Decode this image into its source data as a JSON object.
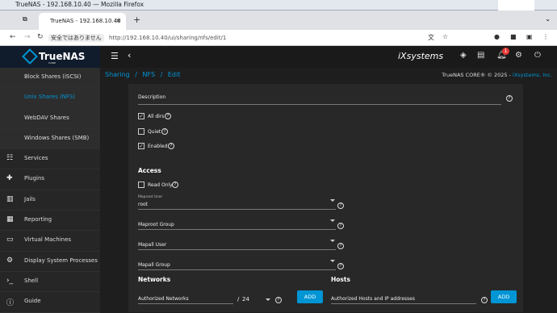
{
  "os": {
    "title": "TrueNAS - 192.168.10.40 — Mozilla Firefox"
  },
  "browser": {
    "tab_label": "TrueNAS - 192.168.10.40",
    "security": "安全ではありません",
    "url": "http://192.168.10.40/ui/sharing/nfs/edit/1"
  },
  "brand": {
    "name": "TrueNAS",
    "edition": "CORE",
    "ix": "iXsystems"
  },
  "notifications": {
    "count": "1"
  },
  "sidebar": {
    "items": [
      {
        "label": "Block Shares (iSCSI)",
        "icon": "none"
      },
      {
        "label": "Unix Shares (NFS)",
        "icon": "none"
      },
      {
        "label": "WebDAV Shares",
        "icon": "none"
      },
      {
        "label": "Windows Shares (SMB)",
        "icon": "none"
      },
      {
        "label": "Services",
        "icon": "sliders-icon"
      },
      {
        "label": "Plugins",
        "icon": "puzzle-icon"
      },
      {
        "label": "Jails",
        "icon": "jail-icon"
      },
      {
        "label": "Reporting",
        "icon": "chart-icon"
      },
      {
        "label": "Virtual Machines",
        "icon": "monitor-icon"
      },
      {
        "label": "Display System Processes",
        "icon": "cog-icon"
      },
      {
        "label": "Shell",
        "icon": "terminal-icon"
      },
      {
        "label": "Guide",
        "icon": "info-icon"
      }
    ]
  },
  "breadcrumb": {
    "a": "Sharing",
    "sep": "/",
    "b": "NFS",
    "c": "Edit"
  },
  "copyright": {
    "text": "TrueNAS CORE® © 2025 - ",
    "link": "iXsystems, Inc."
  },
  "form": {
    "description_label": "Description",
    "all_dirs": "All dirs",
    "quiet": "Quiet",
    "enabled": "Enabled",
    "access_heading": "Access",
    "read_only": "Read Only",
    "maproot_user_label": "Maproot User",
    "maproot_user_value": "root",
    "maproot_group": "Maproot Group",
    "mapall_user": "Mapall User",
    "mapall_group": "Mapall Group",
    "networks_heading": "Networks",
    "hosts_heading": "Hosts",
    "auth_networks": "Authorized Networks",
    "mask_sep": "/",
    "mask": "24",
    "auth_hosts": "Authorized Hosts and IP addresses",
    "add": "ADD"
  },
  "colors": {
    "accent": "#0095d5",
    "topbar": "#1a1a1a",
    "sidebar": "#262626",
    "panel": "#282828"
  }
}
